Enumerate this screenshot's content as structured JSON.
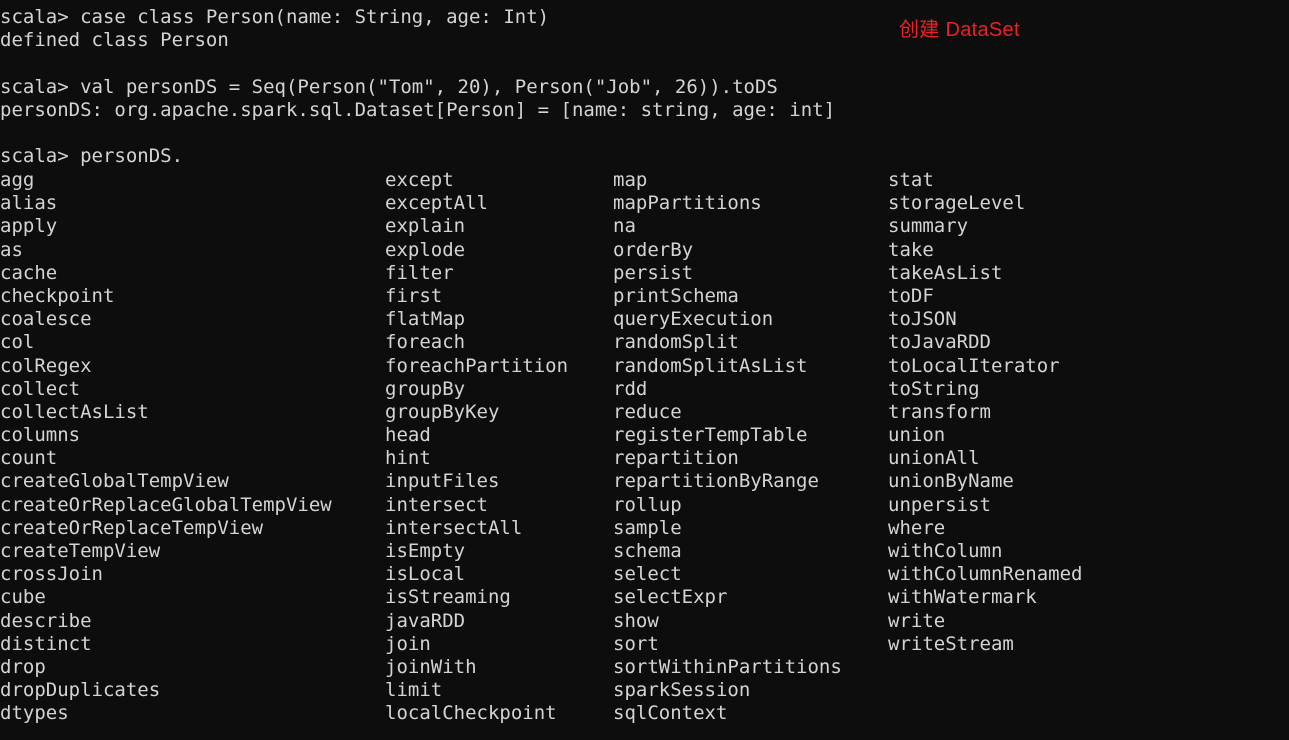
{
  "terminal": {
    "background_color": "#0d0d0d",
    "text_color": "#d4d4d4",
    "prompt": "scala>"
  },
  "annotation": {
    "text": "创建 DataSet",
    "color": "#ed2024"
  },
  "repl": {
    "lines": [
      "scala> case class Person(name: String, age: Int)",
      "defined class Person",
      "",
      "scala> val personDS = Seq(Person(\"Tom\", 20), Person(\"Job\", 26)).toDS",
      "personDS: org.apache.spark.sql.Dataset[Person] = [name: string, age: int]",
      "",
      "scala> personDS."
    ]
  },
  "completions": {
    "columns": [
      [
        "agg",
        "alias",
        "apply",
        "as",
        "cache",
        "checkpoint",
        "coalesce",
        "col",
        "colRegex",
        "collect",
        "collectAsList",
        "columns",
        "count",
        "createGlobalTempView",
        "createOrReplaceGlobalTempView",
        "createOrReplaceTempView",
        "createTempView",
        "crossJoin",
        "cube",
        "describe",
        "distinct",
        "drop",
        "dropDuplicates",
        "dtypes"
      ],
      [
        "except",
        "exceptAll",
        "explain",
        "explode",
        "filter",
        "first",
        "flatMap",
        "foreach",
        "foreachPartition",
        "groupBy",
        "groupByKey",
        "head",
        "hint",
        "inputFiles",
        "intersect",
        "intersectAll",
        "isEmpty",
        "isLocal",
        "isStreaming",
        "javaRDD",
        "join",
        "joinWith",
        "limit",
        "localCheckpoint"
      ],
      [
        "map",
        "mapPartitions",
        "na",
        "orderBy",
        "persist",
        "printSchema",
        "queryExecution",
        "randomSplit",
        "randomSplitAsList",
        "rdd",
        "reduce",
        "registerTempTable",
        "repartition",
        "repartitionByRange",
        "rollup",
        "sample",
        "schema",
        "select",
        "selectExpr",
        "show",
        "sort",
        "sortWithinPartitions",
        "sparkSession",
        "sqlContext"
      ],
      [
        "stat",
        "storageLevel",
        "summary",
        "take",
        "takeAsList",
        "toDF",
        "toJSON",
        "toJavaRDD",
        "toLocalIterator",
        "toString",
        "transform",
        "union",
        "unionAll",
        "unionByName",
        "unpersist",
        "where",
        "withColumn",
        "withColumnRenamed",
        "withWatermark",
        "write",
        "writeStream"
      ]
    ]
  }
}
